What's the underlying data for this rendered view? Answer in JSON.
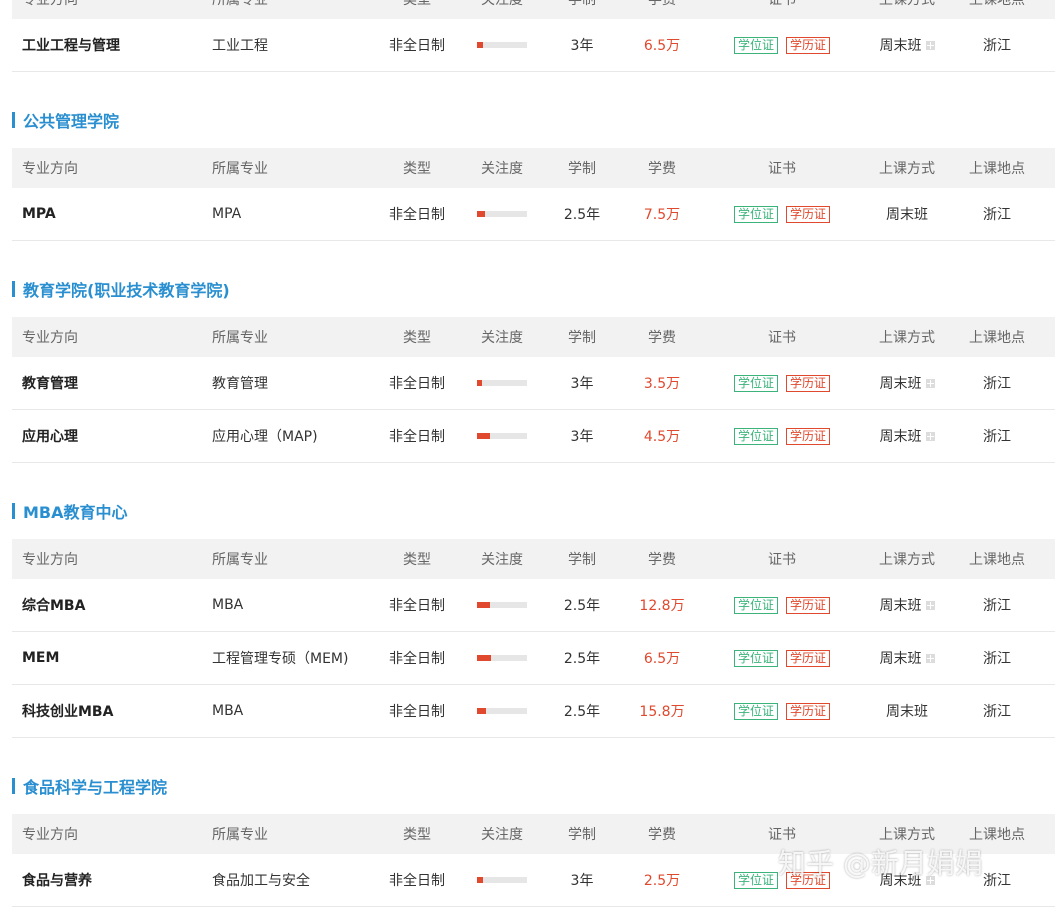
{
  "headers": {
    "direction": "专业方向",
    "major": "所属专业",
    "type": "类型",
    "attention": "关注度",
    "duration": "学制",
    "fee": "学费",
    "cert": "证书",
    "mode": "上课方式",
    "location": "上课地点"
  },
  "top_row": {
    "direction": "工业工程与管理",
    "major": "工业工程",
    "type": "非全日制",
    "attention": 0.12,
    "duration": "3年",
    "fee": "6.5万",
    "cert_degree": "学位证",
    "cert_edu": "学历证",
    "mode": "周末班",
    "location": "浙江"
  },
  "sections": [
    {
      "title": "公共管理学院",
      "rows": [
        {
          "direction": "MPA",
          "major": "MPA",
          "type": "非全日制",
          "attention": 0.15,
          "duration": "2.5年",
          "fee": "7.5万",
          "cert_degree": "学位证",
          "cert_edu": "学历证",
          "mode": "周末班",
          "location": "浙江"
        }
      ]
    },
    {
      "title": "教育学院(职业技术教育学院)",
      "rows": [
        {
          "direction": "教育管理",
          "major": "教育管理",
          "type": "非全日制",
          "attention": 0.1,
          "duration": "3年",
          "fee": "3.5万",
          "cert_degree": "学位证",
          "cert_edu": "学历证",
          "mode": "周末班",
          "location": "浙江"
        },
        {
          "direction": "应用心理",
          "major": "应用心理（MAP)",
          "type": "非全日制",
          "attention": 0.25,
          "duration": "3年",
          "fee": "4.5万",
          "cert_degree": "学位证",
          "cert_edu": "学历证",
          "mode": "周末班",
          "location": "浙江"
        }
      ]
    },
    {
      "title": "MBA教育中心",
      "rows": [
        {
          "direction": "综合MBA",
          "major": "MBA",
          "type": "非全日制",
          "attention": 0.25,
          "duration": "2.5年",
          "fee": "12.8万",
          "cert_degree": "学位证",
          "cert_edu": "学历证",
          "mode": "周末班",
          "location": "浙江"
        },
        {
          "direction": "MEM",
          "major": "工程管理专硕（MEM)",
          "type": "非全日制",
          "attention": 0.28,
          "duration": "2.5年",
          "fee": "6.5万",
          "cert_degree": "学位证",
          "cert_edu": "学历证",
          "mode": "周末班",
          "location": "浙江"
        },
        {
          "direction": "科技创业MBA",
          "major": "MBA",
          "type": "非全日制",
          "attention": 0.18,
          "duration": "2.5年",
          "fee": "15.8万",
          "cert_degree": "学位证",
          "cert_edu": "学历证",
          "mode": "周末班",
          "location": "浙江"
        }
      ]
    },
    {
      "title": "食品科学与工程学院",
      "rows": [
        {
          "direction": "食品与营养",
          "major": "食品加工与安全",
          "type": "非全日制",
          "attention": 0.12,
          "duration": "3年",
          "fee": "2.5万",
          "cert_degree": "学位证",
          "cert_edu": "学历证",
          "mode": "周末班",
          "location": "浙江"
        }
      ]
    }
  ],
  "watermark": "知乎 @新月娟娟"
}
